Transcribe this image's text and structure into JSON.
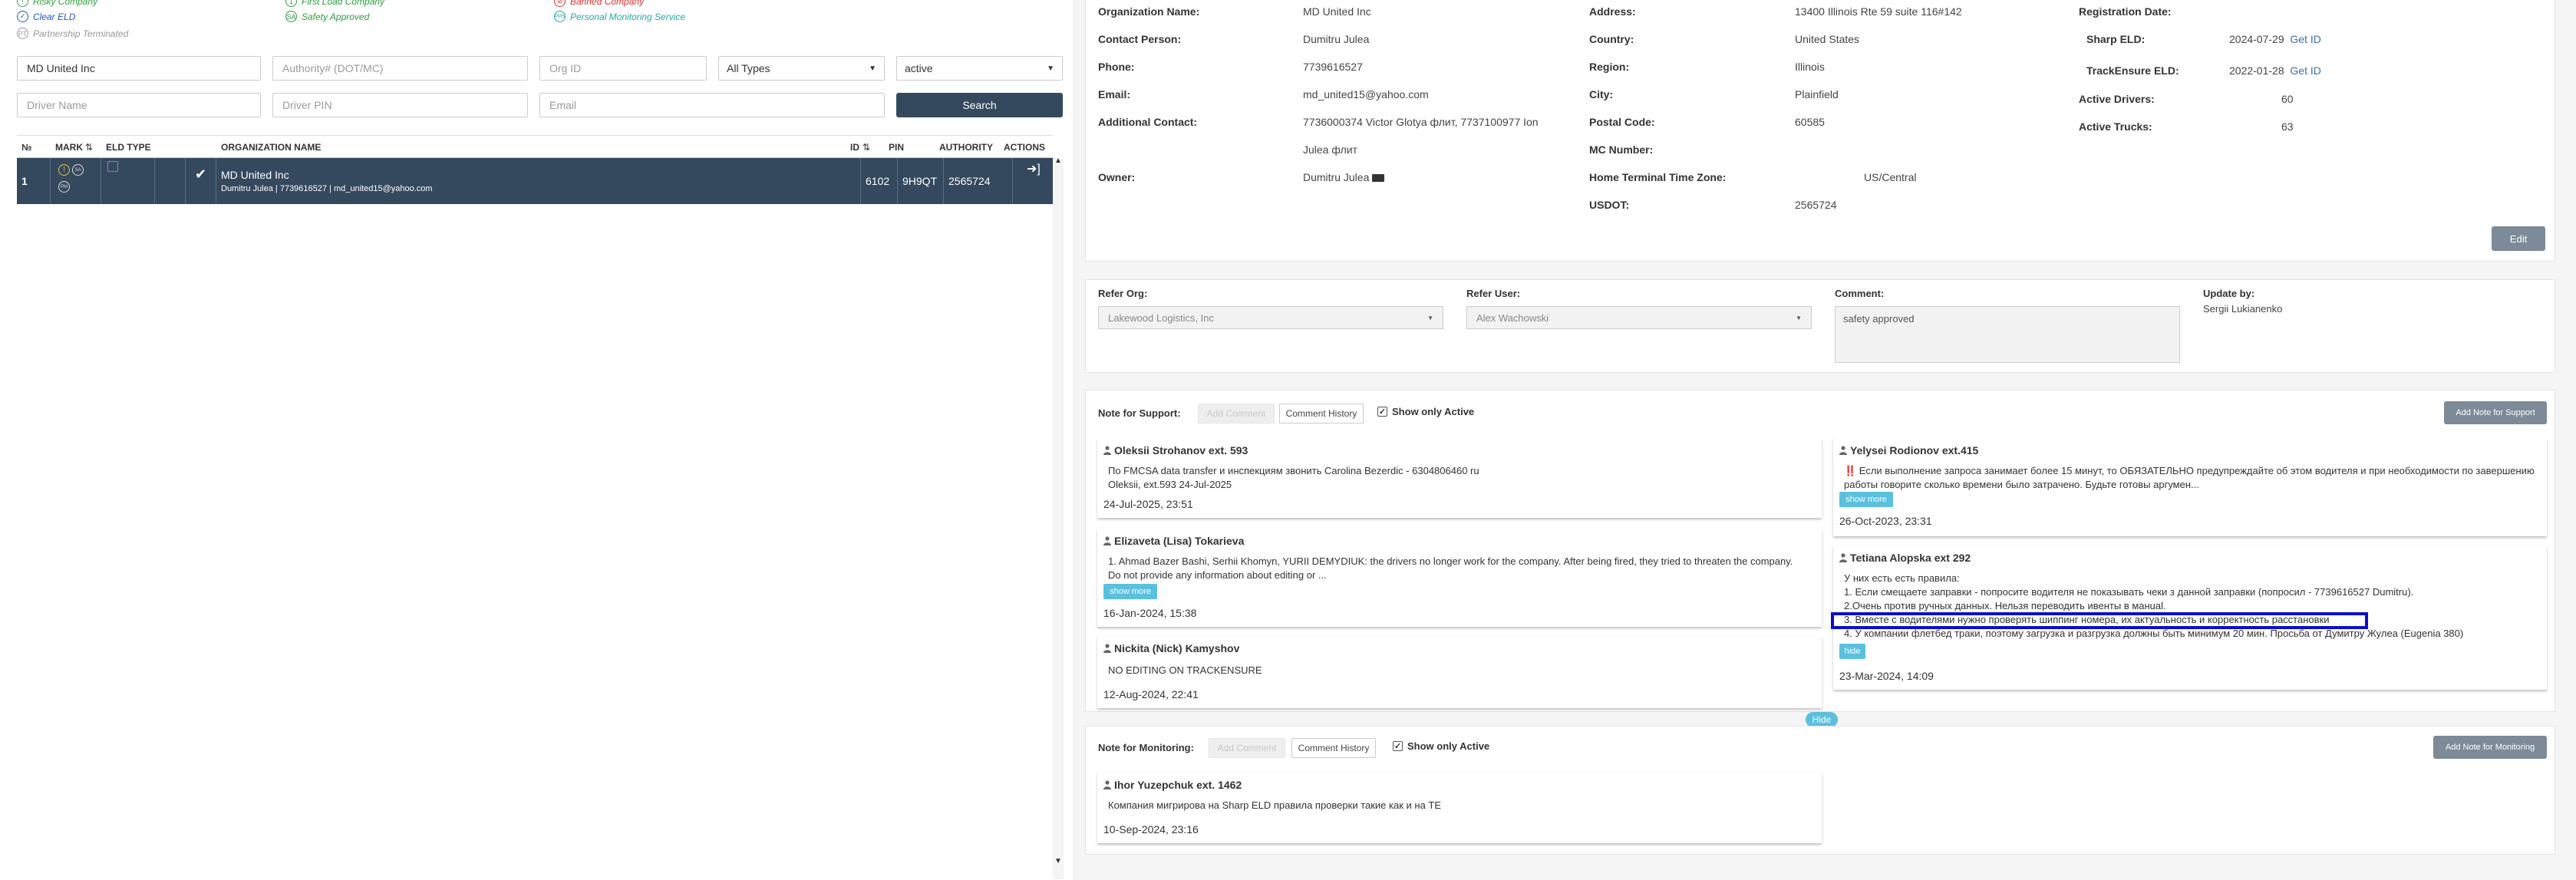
{
  "legend": {
    "col1": [
      {
        "label": "Risky Company",
        "color": "#2e9e3e",
        "icon": "risk-icon"
      },
      {
        "label": "Clear ELD",
        "color": "#2255cc",
        "icon": "clear-eld-icon"
      },
      {
        "label": "Partnership Terminated",
        "color": "#999999",
        "icon": "terminated-icon"
      }
    ],
    "col2": [
      {
        "label": "First Load Company",
        "color": "#2e9e3e",
        "icon": "first-load-icon"
      },
      {
        "label": "Safety Approved",
        "color": "#2e9e3e",
        "icon": "safety-approved-icon",
        "glyph": "SA"
      }
    ],
    "col3": [
      {
        "label": "Banned Company",
        "color": "#e03030",
        "icon": "banned-icon"
      },
      {
        "label": "Personal Monitoring Service",
        "color": "#20a9a0",
        "icon": "monitoring-icon",
        "glyph": "PMS"
      }
    ]
  },
  "filters": {
    "org_name": {
      "value": "MD United Inc",
      "placeholder": ""
    },
    "authority": {
      "placeholder": "Authority# (DOT/MC)"
    },
    "org_id": {
      "placeholder": "Org ID"
    },
    "type": {
      "value": "All Types"
    },
    "status": {
      "value": "active"
    },
    "driver_name": {
      "placeholder": "Driver Name"
    },
    "driver_pin": {
      "placeholder": "Driver PIN"
    },
    "email": {
      "placeholder": "Email"
    },
    "search_label": "Search"
  },
  "table": {
    "headers": {
      "no": "№",
      "mark": "MARK",
      "eld": "ELD TYPE",
      "org": "ORGANIZATION NAME",
      "id": "ID",
      "pin": "PIN",
      "authority": "AUTHORITY",
      "actions": "ACTIONS"
    },
    "rows": [
      {
        "no": "1",
        "org_name": "MD United Inc",
        "org_sub": "Dumitru Julea | 7739616527 | md_united15@yahoo.com",
        "id": "6102",
        "pin": "9H9QT",
        "authority": "2565724"
      }
    ]
  },
  "org": {
    "labels": {
      "org_name": "Organization Name:",
      "contact": "Contact Person:",
      "phone": "Phone:",
      "email": "Email:",
      "additional": "Additional Contact:",
      "owner": "Owner:",
      "address": "Address:",
      "country": "Country:",
      "region": "Region:",
      "city": "City:",
      "postal": "Postal Code:",
      "mc": "MC Number:",
      "home_tz": "Home Terminal Time Zone:",
      "usdot": "USDOT:",
      "reg_date": "Registration Date:",
      "sharp": "Sharp ELD:",
      "trackensure": "TrackEnsure ELD:",
      "drivers": "Active Drivers:",
      "trucks": "Active Trucks:"
    },
    "values": {
      "org_name": "MD United Inc",
      "contact": "Dumitru Julea",
      "phone": "7739616527",
      "email": "md_united15@yahoo.com",
      "additional_1": "7736000374 Victor Glotya флит, 7737100977 Ion",
      "additional_2": "Julea флит",
      "owner": "Dumitru Julea",
      "address": "13400 Illinois Rte 59 suite 116#142",
      "country": "United States",
      "region": "Illinois",
      "city": "Plainfield",
      "postal": "60585",
      "home_tz": "US/Central",
      "usdot": "2565724",
      "sharp_date": "2024-07-29",
      "sharp_link": "Get ID",
      "te_date": "2022-01-28",
      "te_link": "Get ID",
      "drivers": "60",
      "trucks": "63"
    },
    "edit_label": "Edit"
  },
  "refer": {
    "org_label": "Refer Org:",
    "org_value": "Lakewood Logistics, Inc",
    "user_label": "Refer User:",
    "user_value": "Alex Wachowski",
    "comment_label": "Comment:",
    "comment_value": "safety approved",
    "update_label": "Update by:",
    "update_value": "Sergii Lukianenko"
  },
  "support": {
    "title": "Note for Support:",
    "add_comment": "Add Comment",
    "history": "Comment History",
    "show_active": "Show only Active",
    "add_note": "Add Note for Support",
    "hide": "Hide",
    "notes_left": [
      {
        "author": "Oleksii Strohanov ext. 593",
        "lines": [
          "По FMCSA data transfer и инспекциям звонить Carolina Bezerdic - 6304806460 ru",
          "Oleksii, ext.593 24-Jul-2025"
        ],
        "date": "24-Jul-2025, 23:51"
      },
      {
        "author": "Elizaveta (Lisa) Tokarieva",
        "lines": [
          "1. Ahmad Bazer Bashi, Serhii Khomyn, YURII DEMYDIUK: the drivers no longer work for the company. After being fired, they tried to threaten the company.",
          "Do not provide any information about editing or ..."
        ],
        "more": "show more",
        "date": "16-Jan-2024, 15:38"
      },
      {
        "author": "Nickita (Nick) Kamyshov",
        "lines": [
          "NO EDITING ON TRACKENSURE"
        ],
        "date": "12-Aug-2024, 22:41"
      }
    ],
    "notes_right": [
      {
        "author": "Yelysei Rodionov ext.415",
        "lines": [
          "‼️ Если выполнение запроса занимает более 15 минут, то ОБЯЗАТЕЛЬНО предупреждайте об этом водителя и при необходимости по завершению",
          "работы говорите сколько времени было затрачено. Будьте готовы аргумен..."
        ],
        "more": "show more",
        "date": "26-Oct-2023, 23:31"
      },
      {
        "author": "Tetiana Alopska ext 292",
        "lines": [
          "У них есть есть правила:",
          "1. Если смещаете заправки - попросите водителя не показывать чеки з данной заправки (попросил - 7739616527 Dumitru).",
          "2.Очень против ручных данных. Нельзя переводить ивенты в манual.",
          "3. Вместе с водителями нужно проверять шиппинг номера, их актуальность и корректность расстановки",
          "4. У компании флетбед траки, поэтому загрузка и разгрузка должны быть минимум 20 мин. Просьба от Думитру Жулеа (Eugenia 380)"
        ],
        "more": "hide",
        "date": "23-Mar-2024, 14:09"
      }
    ]
  },
  "monitoring": {
    "title": "Note for Monitoring:",
    "add_comment": "Add Comment",
    "history": "Comment History",
    "show_active": "Show only Active",
    "add_note": "Add Note for Monitoring",
    "notes": [
      {
        "author": "Ihor Yuzepchuk ext. 1462",
        "lines": [
          "Компания мигрирова на Sharp ELD правила проверки такие как и на TE"
        ],
        "date": "10-Sep-2024, 23:16"
      }
    ]
  }
}
